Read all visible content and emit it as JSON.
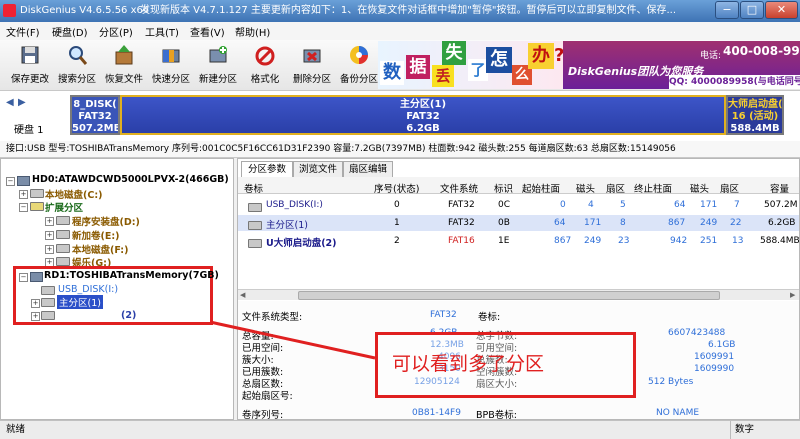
{
  "window": {
    "title": "DiskGenius V4.6.5.56 x64",
    "update_msg": "发现新版本 V4.7.1.127 主要更新内容如下：1、在恢复文件对话框中增加\"暂停\"按钮。暂停后可以立即复制文件、保存...",
    "minimize": "−",
    "maximize": "□",
    "close": "✕"
  },
  "menu": [
    "文件(F)",
    "硬盘(D)",
    "分区(P)",
    "工具(T)",
    "查看(V)",
    "帮助(H)"
  ],
  "toolbar": [
    "保存更改",
    "搜索分区",
    "恢复文件",
    "快速分区",
    "新建分区",
    "格式化",
    "删除分区",
    "备份分区"
  ],
  "banner": {
    "chars": [
      "数",
      "据",
      "丢",
      "失",
      "了",
      "怎",
      "么",
      "办",
      "?"
    ],
    "brand": "DiskGenius团队为您服务",
    "phone_label": "电话:",
    "phone": "400-008-9958",
    "qq": "QQ: 4000089958(与电话同号)"
  },
  "diskbar": {
    "label": "硬盘 1",
    "segments": [
      {
        "name": "8_DISK(",
        "fs": "FAT32",
        "size": "507.2MB"
      },
      {
        "name": "主分区(1)",
        "fs": "FAT32",
        "size": "6.2GB"
      },
      {
        "name": "大师启动盘(",
        "fs": "16 (活动)",
        "size": "588.4MB"
      }
    ]
  },
  "infobar": "接口:USB  型号:TOSHIBATransMemory  序列号:001C0C5F16CC61D31F2390  容量:7.2GB(7397MB)  柱面数:942  磁头数:255  每道扇区数:63  总扇区数:15149056",
  "tree": {
    "hd0": "HD0:ATAWDCWD5000LPVX-2(466GB)",
    "items": [
      "本地磁盘(C:)",
      "扩展分区",
      "程序安装盘(D:)",
      "新加卷(E:)",
      "本地磁盘(F:)",
      "娱乐(G:)"
    ],
    "rd1": "RD1:TOSHIBATransMemory(7GB)",
    "rd1_items": [
      "USB_DISK(I:)",
      "主分区(1)",
      "(2)"
    ]
  },
  "tabs": [
    "分区参数",
    "浏览文件",
    "扇区编辑"
  ],
  "table": {
    "headers": [
      "卷标",
      "序号(状态)",
      "文件系统",
      "标识",
      "起始柱面",
      "磁头",
      "扇区",
      "终止柱面",
      "磁头",
      "扇区",
      "容量"
    ],
    "rows": [
      [
        "USB_DISK(I:)",
        "0",
        "FAT32",
        "0C",
        "0",
        "4",
        "5",
        "64",
        "171",
        "7",
        "507.2M"
      ],
      [
        "主分区(1)",
        "1",
        "FAT32",
        "0B",
        "64",
        "171",
        "8",
        "867",
        "249",
        "22",
        "6.2GB"
      ],
      [
        "U大师启动盘(2)",
        "2",
        "FAT16",
        "1E",
        "867",
        "249",
        "23",
        "942",
        "251",
        "13",
        "588.4MB"
      ]
    ]
  },
  "details": {
    "fs_label": "文件系统类型:",
    "fs_value": "FAT32",
    "vol_label": "卷标:",
    "left": [
      {
        "label": "总容量:",
        "value": "6.2GB"
      },
      {
        "label": "已用空间:",
        "value": "12.3MB"
      },
      {
        "label": "簇大小:",
        "value": "4096"
      },
      {
        "label": "已用簇数:",
        "value": "3150"
      },
      {
        "label": "总扇区数:",
        "value": "12905124"
      },
      {
        "label": "起始扇区号:",
        "value": ""
      }
    ],
    "right": [
      {
        "label": "总字节数:",
        "value": "6607423488"
      },
      {
        "label": "可用空间:",
        "value": "6.1GB"
      },
      {
        "label": "总簇数:",
        "value": "1609991"
      },
      {
        "label": "空闲簇数:",
        "value": "1609990"
      },
      {
        "label": "扇区大小:",
        "value": "512 Bytes"
      }
    ],
    "serial_label": "卷序列号:",
    "serial_value": "0B81-14F9",
    "bpb_label": "BPB卷标:",
    "bpb_value": "NO NAME"
  },
  "annotation": "可以看到多了分区",
  "status": {
    "left": "就绪",
    "right": "数字"
  },
  "colors": {
    "primary": "#2a3fa8",
    "logical": "#2f6fd8",
    "highlight": "#e02020"
  }
}
